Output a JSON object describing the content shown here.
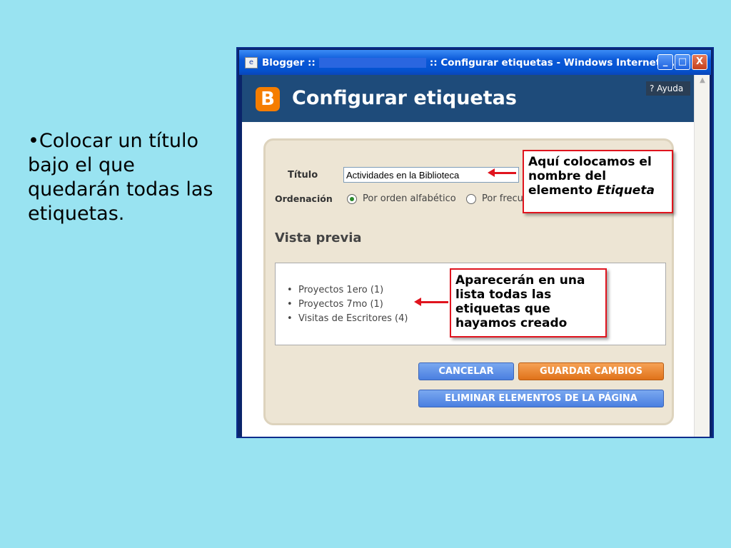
{
  "slide_text": "•Colocar un título bajo el que quedarán todas las etiquetas.",
  "window": {
    "title_left": "Blogger ::",
    "title_right": ":: Configurar etiquetas - Windows Internet ...",
    "btn_min": "_",
    "btn_max": "□",
    "btn_close": "X"
  },
  "header": {
    "logo_letter": "B",
    "title": "Configurar etiquetas",
    "help": "? Ayuda"
  },
  "form": {
    "titulo_label": "Título",
    "titulo_value": "Actividades en la Biblioteca",
    "ordenacion_label": "Ordenación",
    "radio_alpha": "Por orden alfabético",
    "radio_freq": "Por frecu"
  },
  "preview": {
    "title": "Vista previa",
    "items": [
      "Proyectos 1ero (1)",
      "Proyectos 7mo (1)",
      "Visitas de Escritores (4)"
    ]
  },
  "buttons": {
    "cancel": "CANCELAR",
    "save": "GUARDAR CAMBIOS",
    "delete": "ELIMINAR ELEMENTOS DE LA PÁGINA"
  },
  "callouts": {
    "c1_line1": "Aquí colocamos el",
    "c1_line2": "nombre del",
    "c1_line3a": "elemento",
    "c1_line3b": "Etiqueta",
    "c2_line1": "Aparecerán en una",
    "c2_line2": "lista todas las",
    "c2_line3": "etiquetas que",
    "c2_line4": "hayamos creado"
  },
  "colors": {
    "slide_bg": "#99e3f1",
    "header_bg": "#1e4b7a",
    "callout_border": "#e0141e",
    "save_button": "#e0721a",
    "cancel_button": "#4a7fe0"
  }
}
